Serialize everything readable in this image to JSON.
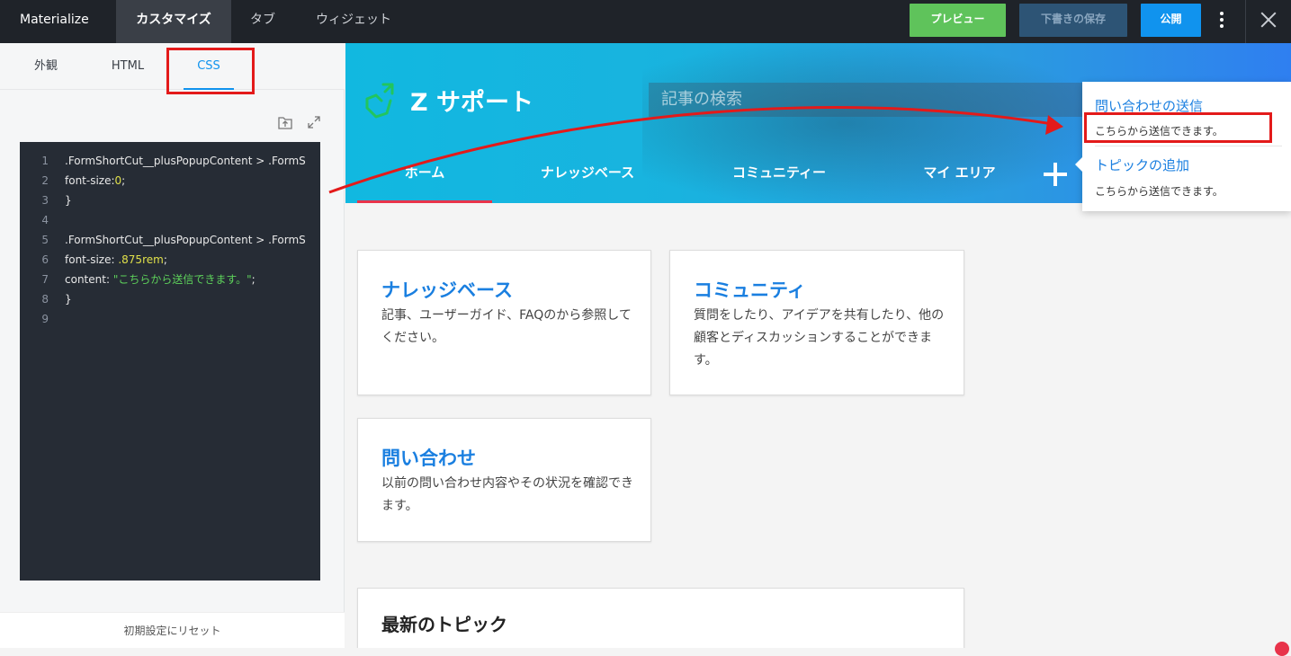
{
  "topbar": {
    "brand": "Materialize",
    "tabs": [
      {
        "label": "カスタマイズ",
        "active": true
      },
      {
        "label": "タブ",
        "active": false
      },
      {
        "label": "ウィジェット",
        "active": false
      }
    ],
    "preview_label": "プレビュー",
    "draft_label": "下書きの保存",
    "publish_label": "公開",
    "colors": {
      "preview": "#5fc35b",
      "draft": "#2d5475",
      "publish": "#1093ee"
    }
  },
  "sidebar": {
    "subtabs": [
      {
        "label": "外観",
        "active": false
      },
      {
        "label": "HTML",
        "active": false
      },
      {
        "label": "CSS",
        "active": true
      }
    ],
    "editor": {
      "lines": [
        {
          "n": "1",
          "text": ".FormShortCut__plusPopupContent > .FormS"
        },
        {
          "n": "2",
          "prefix": "    font-size:",
          "value": "0",
          "suffix": ";"
        },
        {
          "n": "3",
          "text": "}"
        },
        {
          "n": "4",
          "text": ""
        },
        {
          "n": "5",
          "text": ".FormShortCut__plusPopupContent > .FormS"
        },
        {
          "n": "6",
          "prefix": "    font-size: ",
          "value": ".875rem",
          "suffix": ";"
        },
        {
          "n": "7",
          "prefix": "    content: ",
          "string": "\"こちらから送信できます。\"",
          "suffix": ";"
        },
        {
          "n": "8",
          "text": "}"
        },
        {
          "n": "9",
          "text": ""
        }
      ]
    },
    "reset_label": "初期設定にリセット"
  },
  "site": {
    "title": "Z サポート",
    "search_placeholder": "記事の検索",
    "nav": [
      {
        "label": "ホーム",
        "active": true
      },
      {
        "label": "ナレッジベース",
        "active": false
      },
      {
        "label": "コミュニティー",
        "active": false
      },
      {
        "label": "マイ エリア",
        "active": false
      }
    ],
    "cards": [
      {
        "title": "ナレッジベース",
        "desc": "記事、ユーザーガイド、FAQのから参照してください。"
      },
      {
        "title": "コミュニティ",
        "desc": "質問をしたり、アイデアを共有したり、他の顧客とディスカッションすることができます。"
      },
      {
        "title": "問い合わせ",
        "desc": "以前の問い合わせ内容やその状況を確認できます。"
      }
    ],
    "latest_title": "最新のトピック"
  },
  "popup": {
    "items": [
      {
        "title": "問い合わせの送信",
        "desc": "こちらから送信できます。"
      },
      {
        "title": "トピックの追加",
        "desc": "こちらから送信できます。"
      }
    ]
  },
  "annotation_color": "#e31a1a"
}
